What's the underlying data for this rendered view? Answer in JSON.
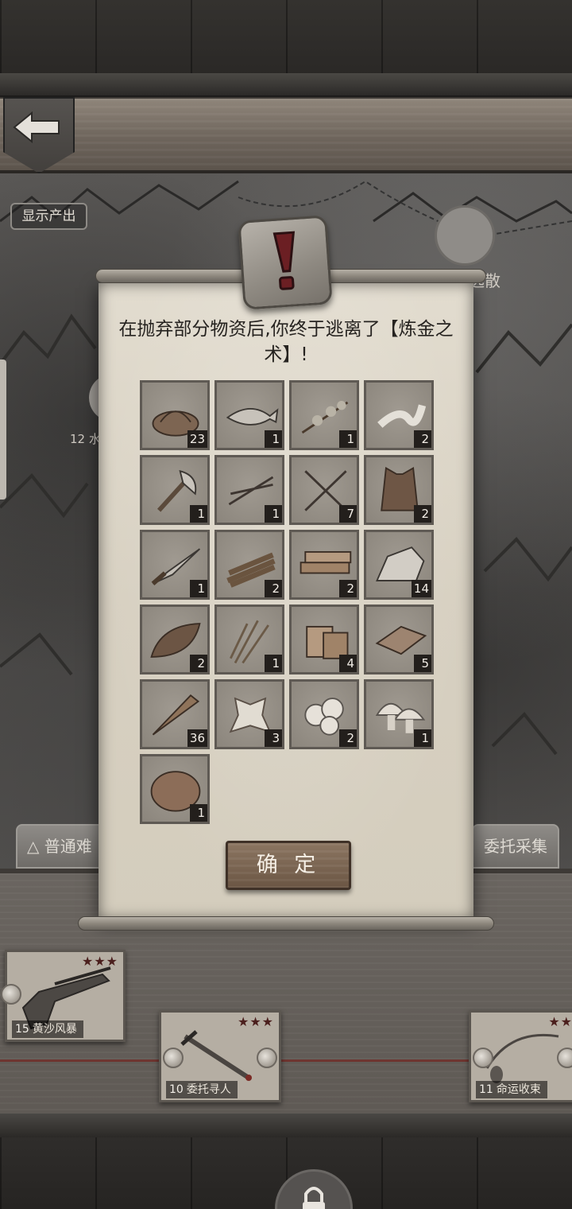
{
  "header": {
    "back_icon": "back-arrow-icon"
  },
  "map": {
    "show_output_label": "显示产出",
    "token_label": "逃散",
    "node_label": "12 水"
  },
  "tabs": {
    "difficulty_label": "普通难",
    "commission_label": "委托采集"
  },
  "quests": [
    {
      "level": "15",
      "name": "黄沙风暴",
      "stars": "★★★",
      "icon": "flintlock-pistol-icon"
    },
    {
      "level": "10",
      "name": "委托寻人",
      "stars": "★★★",
      "icon": "dagger-icon"
    },
    {
      "level": "11",
      "name": "命运收束",
      "stars": "★★",
      "icon": "necklace-icon"
    }
  ],
  "dialog": {
    "alert_icon": "exclamation-icon",
    "message": "在抛弃部分物资后,你终于逃离了【炼金之术】!",
    "confirm_label": "确 定",
    "items": [
      {
        "icon": "rope-coil-icon",
        "count": "23"
      },
      {
        "icon": "fish-icon",
        "count": "1"
      },
      {
        "icon": "herb-branch-icon",
        "count": "1"
      },
      {
        "icon": "bandage-icon",
        "count": "2"
      },
      {
        "icon": "axe-icon",
        "count": "1"
      },
      {
        "icon": "arrows-icon",
        "count": "1"
      },
      {
        "icon": "crossed-arrows-icon",
        "count": "7"
      },
      {
        "icon": "leather-vest-icon",
        "count": "2"
      },
      {
        "icon": "knife-icon",
        "count": "1"
      },
      {
        "icon": "firewood-bundle-icon",
        "count": "2"
      },
      {
        "icon": "wood-planks-icon",
        "count": "2"
      },
      {
        "icon": "stone-icon",
        "count": "14"
      },
      {
        "icon": "leaf-icon",
        "count": "2"
      },
      {
        "icon": "wheat-icon",
        "count": "1"
      },
      {
        "icon": "wood-blocks-icon",
        "count": "4"
      },
      {
        "icon": "board-icon",
        "count": "5"
      },
      {
        "icon": "wooden-stake-icon",
        "count": "36"
      },
      {
        "icon": "animal-hide-icon",
        "count": "3"
      },
      {
        "icon": "cotton-icon",
        "count": "2"
      },
      {
        "icon": "mushroom-icon",
        "count": "1"
      },
      {
        "icon": "potato-icon",
        "count": "1"
      }
    ]
  }
}
